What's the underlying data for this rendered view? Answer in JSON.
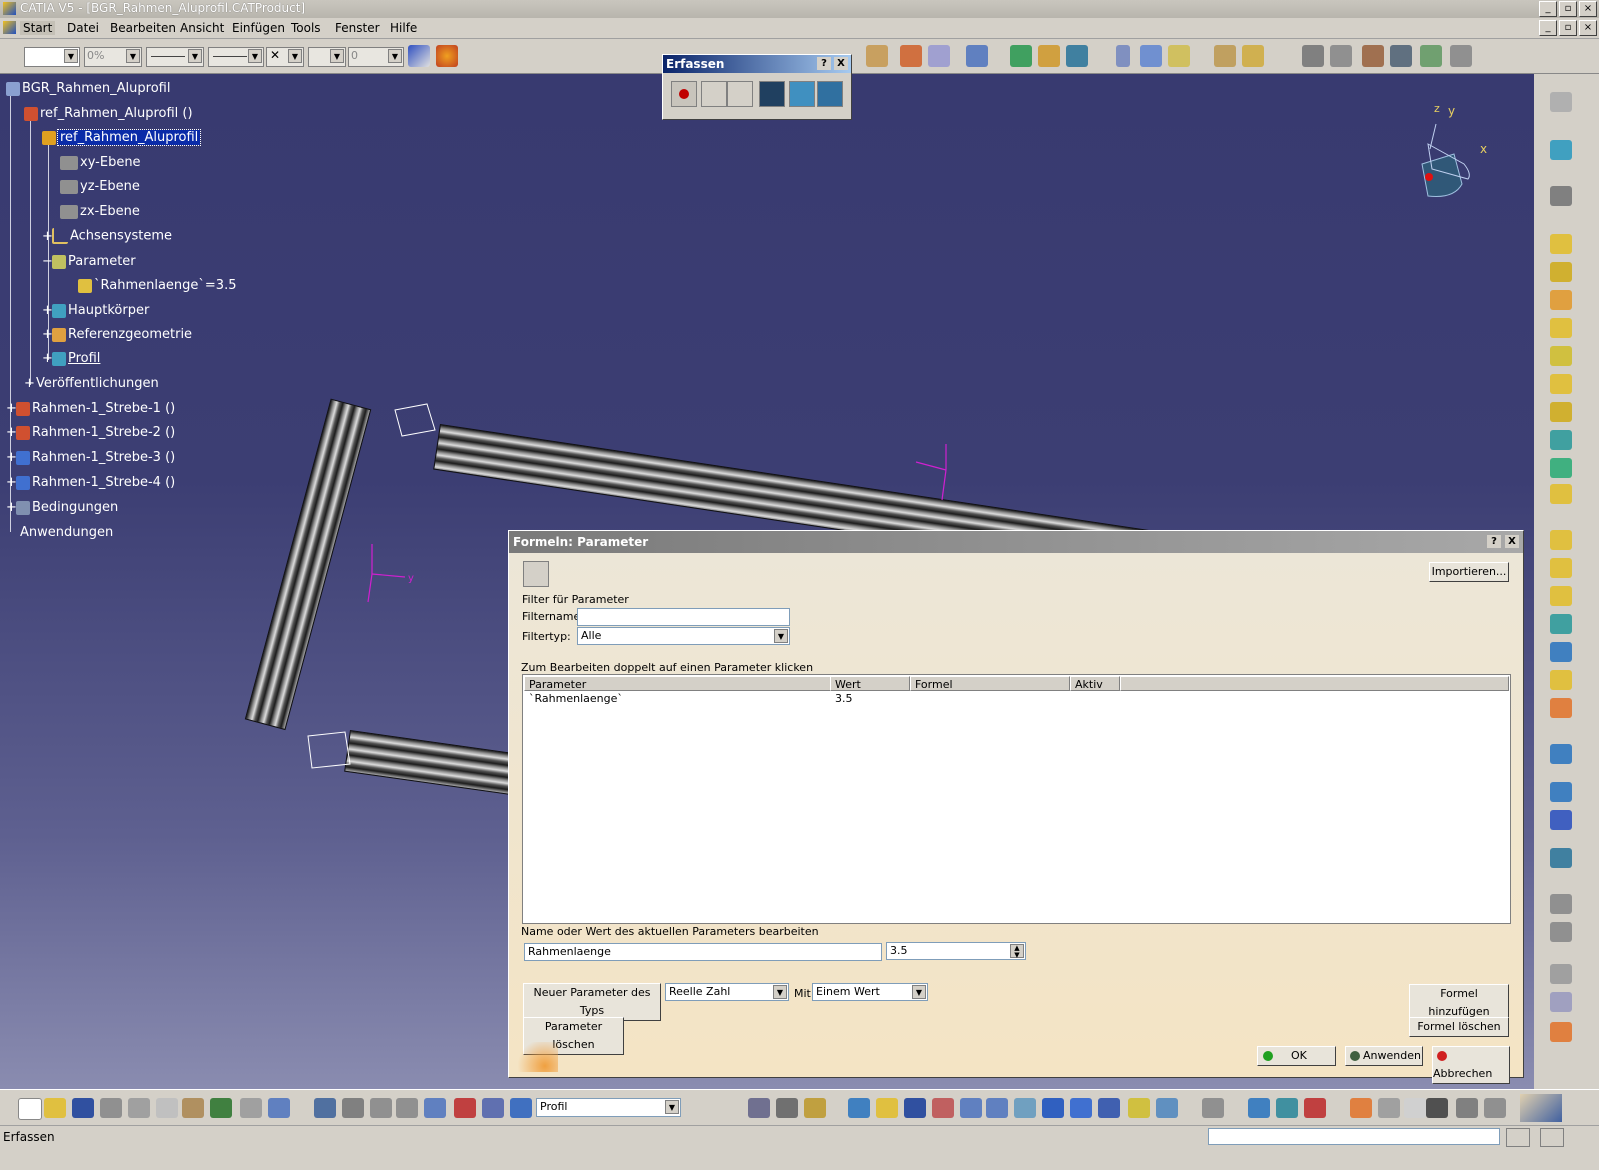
{
  "window": {
    "title": "CATIA V5 - [BGR_Rahmen_Aluprofil.CATProduct]"
  },
  "menu": [
    "Start",
    "Datei",
    "Bearbeiten",
    "Ansicht",
    "Einfügen",
    "Tools",
    "Fenster",
    "Hilfe"
  ],
  "toolbar": {
    "opacity": "0%",
    "thickness": "0"
  },
  "tree": {
    "root": "BGR_Rahmen_Aluprofil",
    "ref_instance": "ref_Rahmen_Aluprofil ()",
    "ref_part": "ref_Rahmen_Aluprofil",
    "xy": "xy-Ebene",
    "yz": "yz-Ebene",
    "zx": "zx-Ebene",
    "axes": "Achsensysteme",
    "params": "Parameter",
    "param_value": "`Rahmenlaenge`=3.5",
    "body": "Hauptkörper",
    "refgeo": "Referenzgeometrie",
    "profil": "Profil",
    "publications": "Veröffentlichungen",
    "strebe1": "Rahmen-1_Strebe-1 ()",
    "strebe2": "Rahmen-1_Strebe-2 ()",
    "strebe3": "Rahmen-1_Strebe-3 ()",
    "strebe4": "Rahmen-1_Strebe-4 ()",
    "constraints": "Bedingungen",
    "apps": "Anwendungen"
  },
  "compass": {
    "z": "z",
    "y": "y",
    "x": "x"
  },
  "erfassen": {
    "title": "Erfassen",
    "help": "?",
    "close": "X"
  },
  "dialog": {
    "title": "Formeln: Parameter",
    "help": "?",
    "close": "X",
    "import": "Importieren...",
    "filter_group": "Filter für Parameter",
    "filtername_label": "Filtername:",
    "filtername_value": "",
    "filtertyp_label": "Filtertyp:",
    "filtertyp_value": "Alle",
    "hint": "Zum Bearbeiten doppelt auf einen Parameter klicken",
    "columns": [
      "Parameter",
      "Wert",
      "Formel",
      "Aktiv"
    ],
    "rows": [
      {
        "parameter": "`Rahmenlaenge`",
        "wert": "3.5",
        "formel": "",
        "aktiv": ""
      }
    ],
    "edit_label": "Name oder Wert des aktuellen Parameters bearbeiten",
    "edit_name": "Rahmenlaenge",
    "edit_value": "3.5",
    "new_param_button": "Neuer Parameter des Typs",
    "type_value": "Reelle Zahl",
    "mit_label": "Mit",
    "mit_value": "Einem Wert",
    "add_formula": "Formel hinzufügen",
    "delete_param": "Parameter löschen",
    "delete_formula": "Formel löschen",
    "ok": "OK",
    "apply": "Anwenden",
    "cancel": "Abbrechen"
  },
  "bottom": {
    "workbench_select": "Profil"
  },
  "status": {
    "text": "Erfassen"
  }
}
